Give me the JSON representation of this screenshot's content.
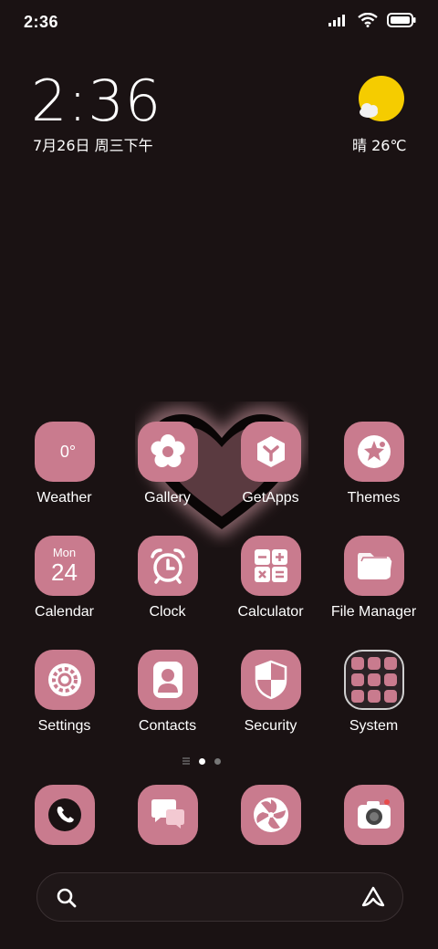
{
  "status_bar": {
    "time": "2:36",
    "icons": [
      "signal-icon",
      "wifi-icon",
      "battery-icon"
    ]
  },
  "clock_widget": {
    "time": "2:36",
    "date": "7月26日 周三下午"
  },
  "weather_widget": {
    "icon": "sunny-cloud-icon",
    "text": "晴 26℃"
  },
  "apps": [
    {
      "label": "Weather",
      "icon": "weather-app-icon",
      "icon_text": "0°"
    },
    {
      "label": "Gallery",
      "icon": "flower-icon"
    },
    {
      "label": "GetApps",
      "icon": "getapps-icon"
    },
    {
      "label": "Themes",
      "icon": "themes-icon"
    },
    {
      "label": "Calendar",
      "icon": "calendar-icon",
      "icon_text_top": "Mon",
      "icon_text": "24"
    },
    {
      "label": "Clock",
      "icon": "alarm-clock-icon"
    },
    {
      "label": "Calculator",
      "icon": "calculator-icon"
    },
    {
      "label": "File Manager",
      "icon": "folder-icon"
    },
    {
      "label": "Settings",
      "icon": "gear-icon"
    },
    {
      "label": "Contacts",
      "icon": "contact-icon"
    },
    {
      "label": "Security",
      "icon": "shield-icon"
    },
    {
      "label": "System",
      "icon": "folder-grid-icon"
    }
  ],
  "dock": [
    {
      "icon": "phone-icon"
    },
    {
      "icon": "messages-icon"
    },
    {
      "icon": "browser-icon"
    },
    {
      "icon": "camera-icon"
    }
  ],
  "colors": {
    "background": "#1a1213",
    "icon_pink": "#c97b8e",
    "sun_yellow": "#f5cc00"
  }
}
